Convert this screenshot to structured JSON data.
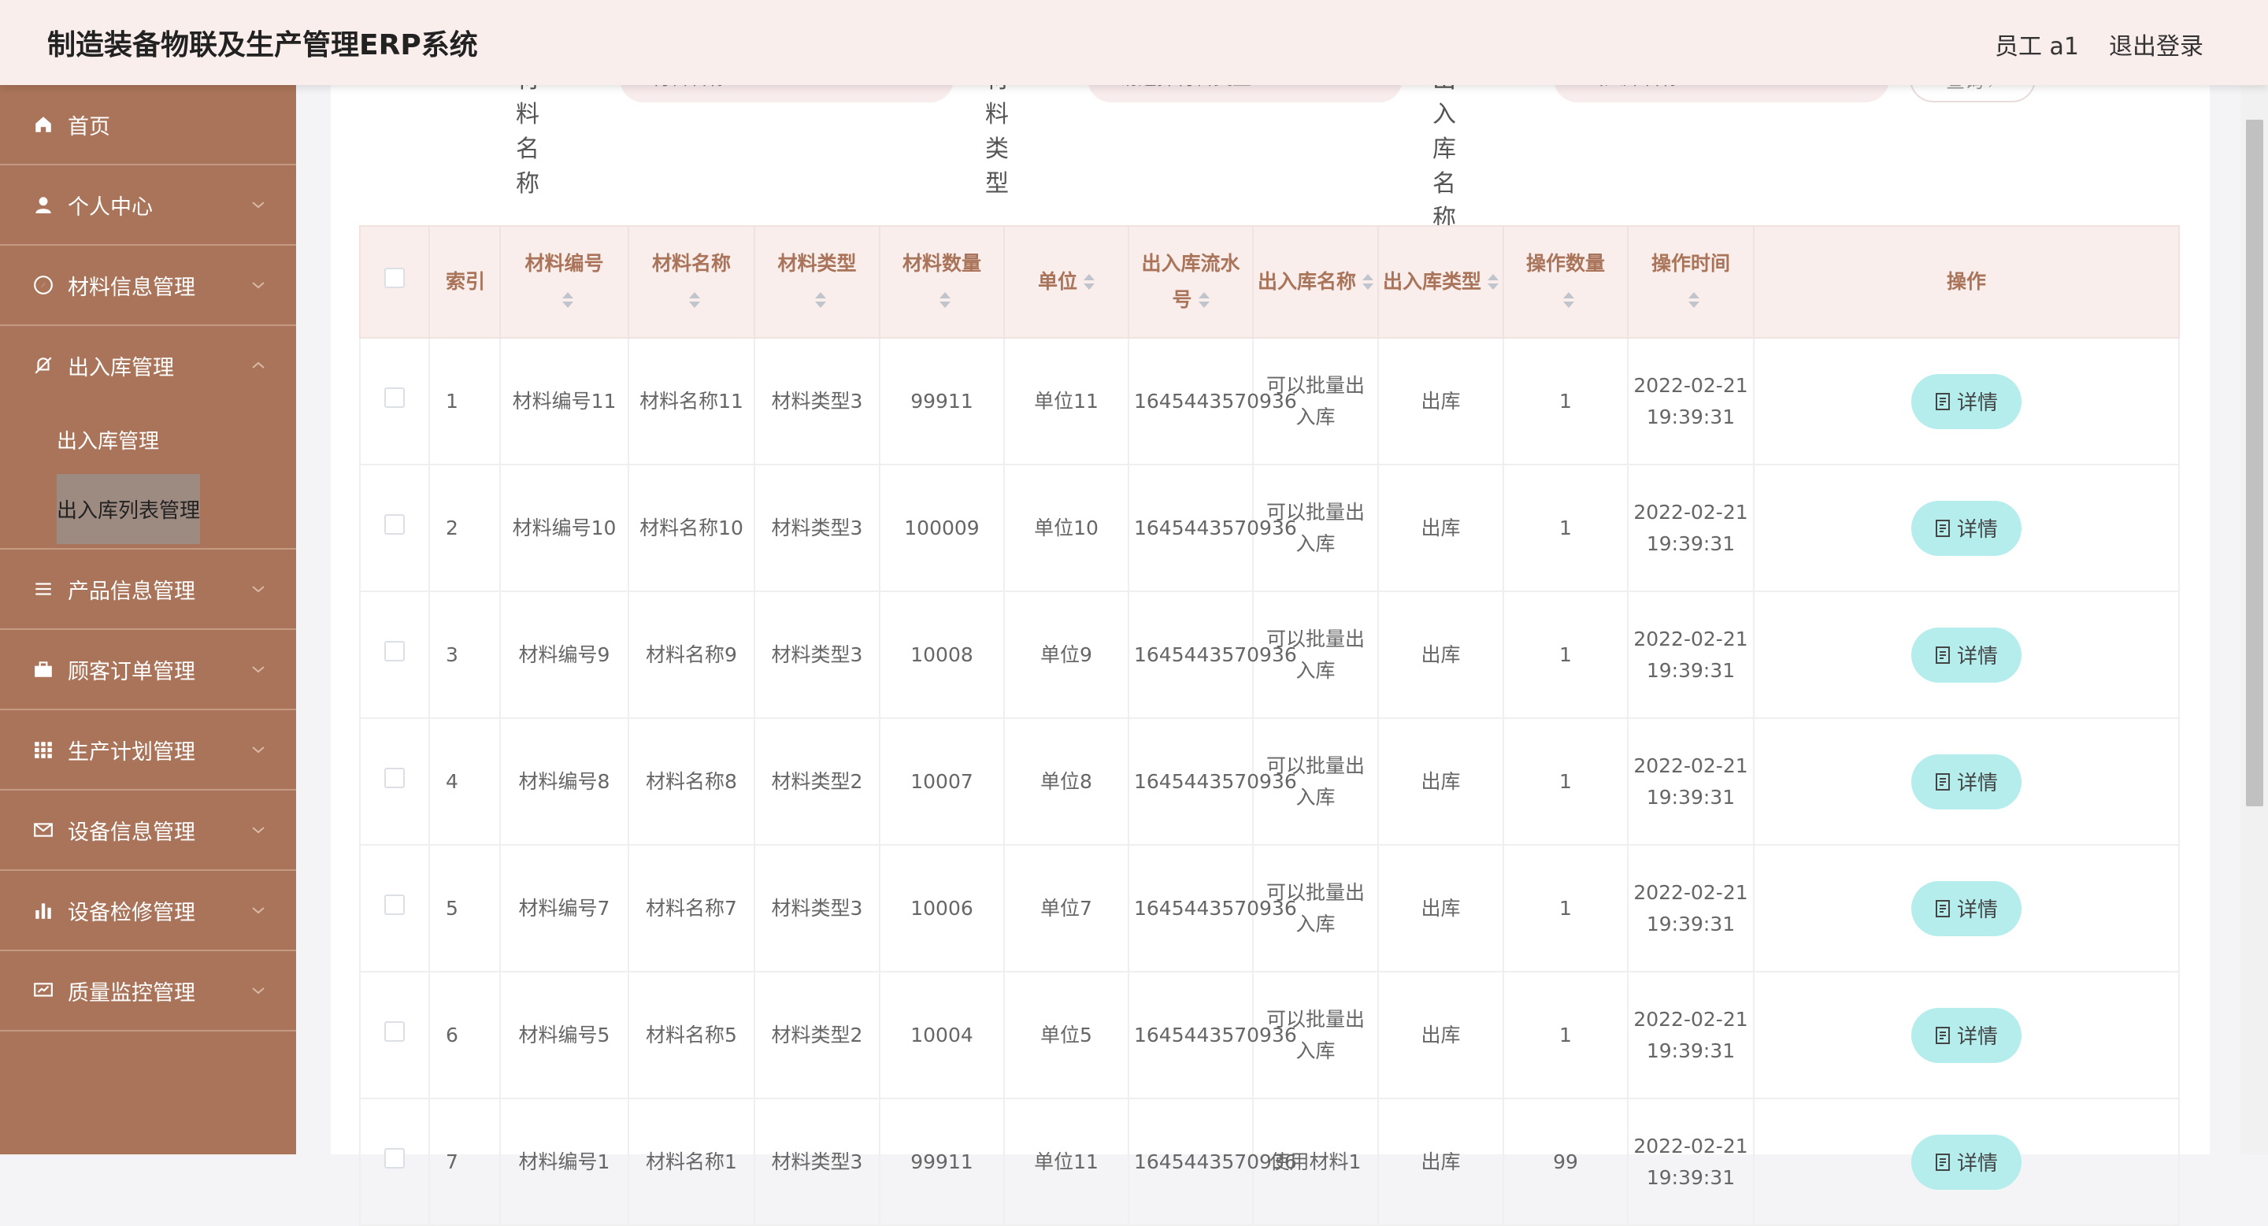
{
  "header": {
    "title": "制造装备物联及生产管理ERP系统",
    "user": "员工 a1",
    "logout": "退出登录"
  },
  "sidebar": {
    "items": [
      {
        "label": "首页"
      },
      {
        "label": "个人中心"
      },
      {
        "label": "材料信息管理"
      },
      {
        "label": "出入库管理",
        "sub": [
          "出入库管理",
          "出入库列表管理"
        ]
      },
      {
        "label": "产品信息管理"
      },
      {
        "label": "顾客订单管理"
      },
      {
        "label": "生产计划管理"
      },
      {
        "label": "设备信息管理"
      },
      {
        "label": "设备检修管理"
      },
      {
        "label": "质量监控管理"
      }
    ]
  },
  "search": {
    "material_name_label": "材料名称",
    "material_name_placeholder": "材料名称",
    "material_type_label": "材料类型",
    "material_type_placeholder": "请选择材料类型",
    "inout_name_label": "出入库名称",
    "inout_name_placeholder": "出入库名称",
    "query_button": "查询"
  },
  "table": {
    "headers": [
      "索引",
      "材料编号",
      "材料名称",
      "材料类型",
      "材料数量",
      "单位",
      "出入库流水号",
      "出入库名称",
      "出入库类型",
      "操作数量",
      "操作时间",
      "操作"
    ],
    "detail_label": "详情",
    "rows": [
      [
        "1",
        "材料编号11",
        "材料名称11",
        "材料类型3",
        "99911",
        "单位11",
        "1645443570936",
        "可以批量出入库",
        "出库",
        "1",
        "2022-02-21 19:39:31"
      ],
      [
        "2",
        "材料编号10",
        "材料名称10",
        "材料类型3",
        "100009",
        "单位10",
        "1645443570936",
        "可以批量出入库",
        "出库",
        "1",
        "2022-02-21 19:39:31"
      ],
      [
        "3",
        "材料编号9",
        "材料名称9",
        "材料类型3",
        "10008",
        "单位9",
        "1645443570936",
        "可以批量出入库",
        "出库",
        "1",
        "2022-02-21 19:39:31"
      ],
      [
        "4",
        "材料编号8",
        "材料名称8",
        "材料类型2",
        "10007",
        "单位8",
        "1645443570936",
        "可以批量出入库",
        "出库",
        "1",
        "2022-02-21 19:39:31"
      ],
      [
        "5",
        "材料编号7",
        "材料名称7",
        "材料类型3",
        "10006",
        "单位7",
        "1645443570936",
        "可以批量出入库",
        "出库",
        "1",
        "2022-02-21 19:39:31"
      ],
      [
        "6",
        "材料编号5",
        "材料名称5",
        "材料类型2",
        "10004",
        "单位5",
        "1645443570936",
        "可以批量出入库",
        "出库",
        "1",
        "2022-02-21 19:39:31"
      ],
      [
        "7",
        "材料编号1",
        "材料名称1",
        "材料类型3",
        "99911",
        "单位11",
        "1645443570936",
        "使用材料1",
        "出库",
        "99",
        "2022-02-21 19:39:31"
      ]
    ]
  },
  "colors": {
    "sidebar": "#a97459",
    "header": "#f9eeec",
    "accent": "#a97459",
    "detail_button": "#b5ecec"
  },
  "icons": [
    "home-icon",
    "user-icon",
    "compass-icon",
    "bell-off-icon",
    "list-icon",
    "briefcase-icon",
    "grid-icon",
    "mail-icon",
    "bar-chart-icon",
    "monitor-icon",
    "document-icon",
    "search-icon",
    "chevron-down-icon"
  ]
}
